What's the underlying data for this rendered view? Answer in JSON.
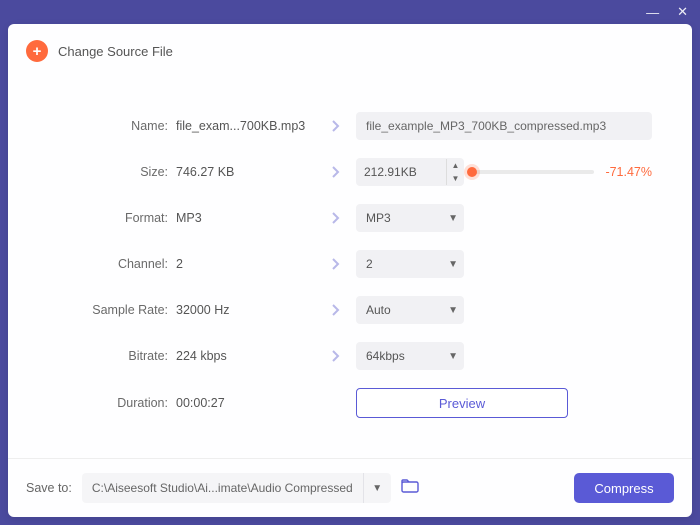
{
  "titlebar": {
    "minimize": "—",
    "close": "✕"
  },
  "source": {
    "label": "Change Source File"
  },
  "rows": {
    "name": {
      "label": "Name:",
      "value": "file_exam...700KB.mp3",
      "output": "file_example_MP3_700KB_compressed.mp3"
    },
    "size": {
      "label": "Size:",
      "value": "746.27 KB",
      "output": "212.91KB",
      "percent": "-71.47%"
    },
    "format": {
      "label": "Format:",
      "value": "MP3",
      "output": "MP3"
    },
    "channel": {
      "label": "Channel:",
      "value": "2",
      "output": "2"
    },
    "samplerate": {
      "label": "Sample Rate:",
      "value": "32000 Hz",
      "output": "Auto"
    },
    "bitrate": {
      "label": "Bitrate:",
      "value": "224 kbps",
      "output": "64kbps"
    },
    "duration": {
      "label": "Duration:",
      "value": "00:00:27",
      "preview": "Preview"
    }
  },
  "footer": {
    "save_label": "Save to:",
    "path": "C:\\Aiseesoft Studio\\Ai...imate\\Audio Compressed",
    "compress": "Compress"
  }
}
